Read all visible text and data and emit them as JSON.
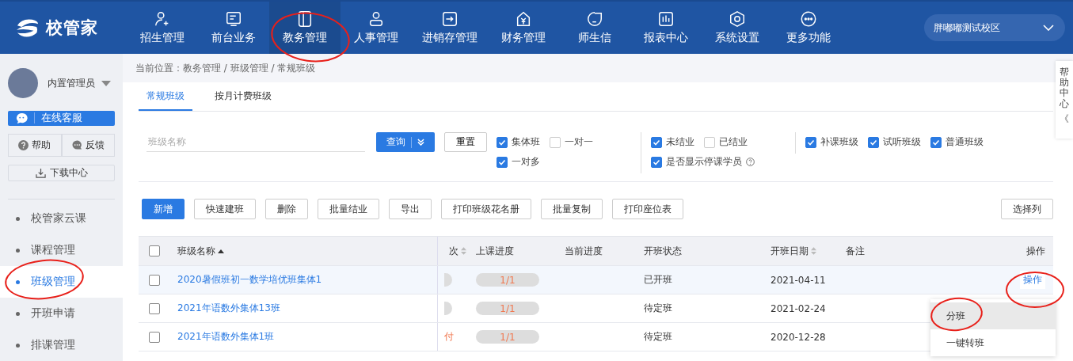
{
  "logo": {
    "text": "校管家"
  },
  "nav": [
    {
      "label": "招生管理",
      "selected": false,
      "circled": false
    },
    {
      "label": "前台业务",
      "selected": false,
      "circled": false
    },
    {
      "label": "教务管理",
      "selected": true,
      "circled": true
    },
    {
      "label": "人事管理",
      "selected": false,
      "circled": false
    },
    {
      "label": "进销存管理",
      "selected": false,
      "circled": false
    },
    {
      "label": "财务管理",
      "selected": false,
      "circled": false
    },
    {
      "label": "师生信",
      "selected": false,
      "circled": false
    },
    {
      "label": "报表中心",
      "selected": false,
      "circled": false
    },
    {
      "label": "系统设置",
      "selected": false,
      "circled": false
    },
    {
      "label": "更多功能",
      "selected": false,
      "circled": false
    }
  ],
  "campus": {
    "value": "胖嘟嘟测试校区"
  },
  "user": {
    "name": "内置管理员"
  },
  "sidebar": {
    "service_button": "在线客服",
    "help": "帮助",
    "feedback": "反馈",
    "download": "下载中心",
    "items": [
      {
        "label": "校管家云课",
        "selected": false,
        "circled": false
      },
      {
        "label": "课程管理",
        "selected": false,
        "circled": false
      },
      {
        "label": "班级管理",
        "selected": true,
        "circled": true
      },
      {
        "label": "开班申请",
        "selected": false,
        "circled": false
      },
      {
        "label": "排课管理",
        "selected": false,
        "circled": false
      }
    ]
  },
  "breadcrumb": "当前位置：教务管理 / 班级管理 / 常规班级",
  "tabs": [
    {
      "label": "常规班级",
      "selected": true
    },
    {
      "label": "按月计费班级",
      "selected": false
    }
  ],
  "search": {
    "placeholder": "班级名称",
    "query_button": "查询",
    "reset_button": "重置"
  },
  "filter_groups": [
    [
      {
        "label": "集体班",
        "checked": true
      },
      {
        "label": "一对一",
        "checked": false
      },
      {
        "label": "一对多",
        "checked": true
      }
    ],
    [
      {
        "label": "未结业",
        "checked": true
      },
      {
        "label": "已结业",
        "checked": false
      },
      {
        "label": "是否显示停课学员",
        "checked": true,
        "help": true
      }
    ],
    [
      {
        "label": "补课班级",
        "checked": true
      },
      {
        "label": "试听班级",
        "checked": true
      },
      {
        "label": "普通班级",
        "checked": true
      }
    ]
  ],
  "toolbar": [
    {
      "label": "新增",
      "kind": "primary"
    },
    {
      "label": "快速建班",
      "kind": "plain"
    },
    {
      "label": "删除",
      "kind": "plain"
    },
    {
      "label": "批量结业",
      "kind": "plain"
    },
    {
      "label": "导出",
      "kind": "plain"
    },
    {
      "label": "打印班级花名册",
      "kind": "plain"
    },
    {
      "label": "批量复制",
      "kind": "plain"
    },
    {
      "label": "打印座位表",
      "kind": "plain"
    }
  ],
  "choose_columns": "选择列",
  "table": {
    "all_checked": false,
    "columns": [
      "班级名称",
      "次",
      "上课进度",
      "当前进度",
      "开班状态",
      "开班日期",
      "备注",
      "操作"
    ],
    "rows": [
      {
        "name": "2020暑假班初一数学培优班集体1",
        "progress": "1/1",
        "status": "已开班",
        "date": "2021-04-11",
        "action": "操作",
        "action_circled": true,
        "selected": true,
        "checked": false
      },
      {
        "name": "2021年语数外集体13班",
        "progress": "1/1",
        "status": "待定班",
        "date": "2021-02-24",
        "selected": false,
        "checked": false
      },
      {
        "name": "2021年语数外集体1班",
        "column_3": "付",
        "progress": "1/1",
        "status": "待定班",
        "date": "2020-12-28",
        "selected": false,
        "checked": false
      }
    ]
  },
  "action_menu": [
    {
      "label": "分班",
      "selected": true,
      "circled": true
    },
    {
      "label": "一键转班",
      "selected": false,
      "circled": false
    }
  ],
  "help_tab": {
    "text": "帮助中心",
    "arrow": "《"
  }
}
